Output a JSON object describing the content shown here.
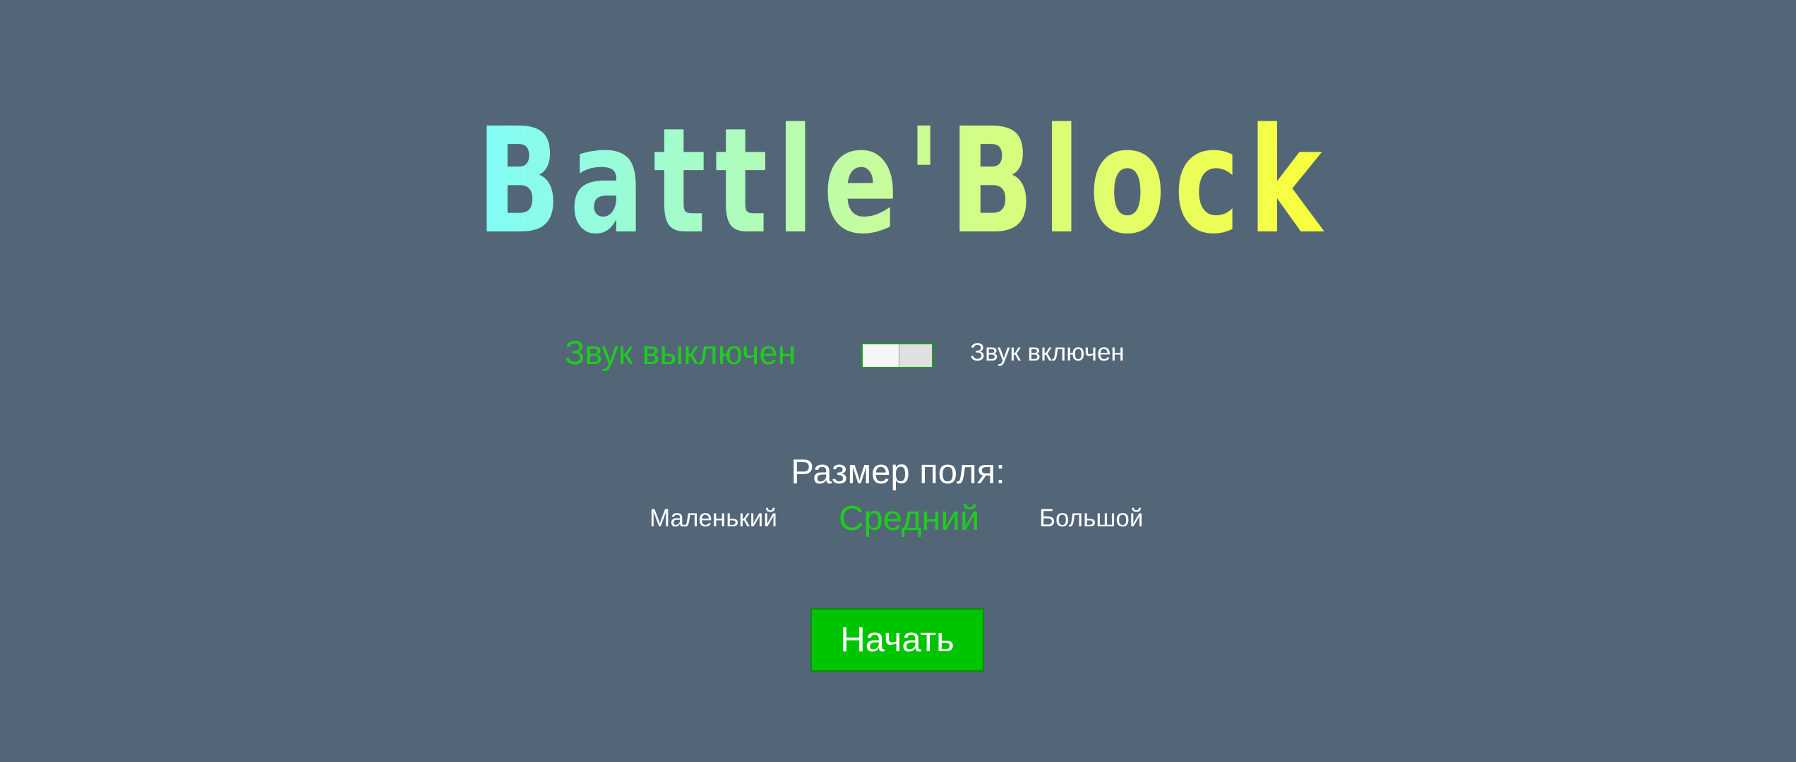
{
  "title": "Battle'Block",
  "colors": {
    "background": "#526678",
    "accent_green": "#1fcc1f",
    "start_button": "#00c400",
    "logo_gradient_start": "#7ffcf8",
    "logo_gradient_end": "#fbff3a"
  },
  "sound": {
    "off_label": "Звук выключен",
    "on_label": "Звук включен",
    "state": "off"
  },
  "field_size": {
    "title": "Размер поля:",
    "options": [
      "Маленький",
      "Средний",
      "Большой"
    ],
    "selected": "Средний"
  },
  "start_button": {
    "label": "Начать"
  }
}
